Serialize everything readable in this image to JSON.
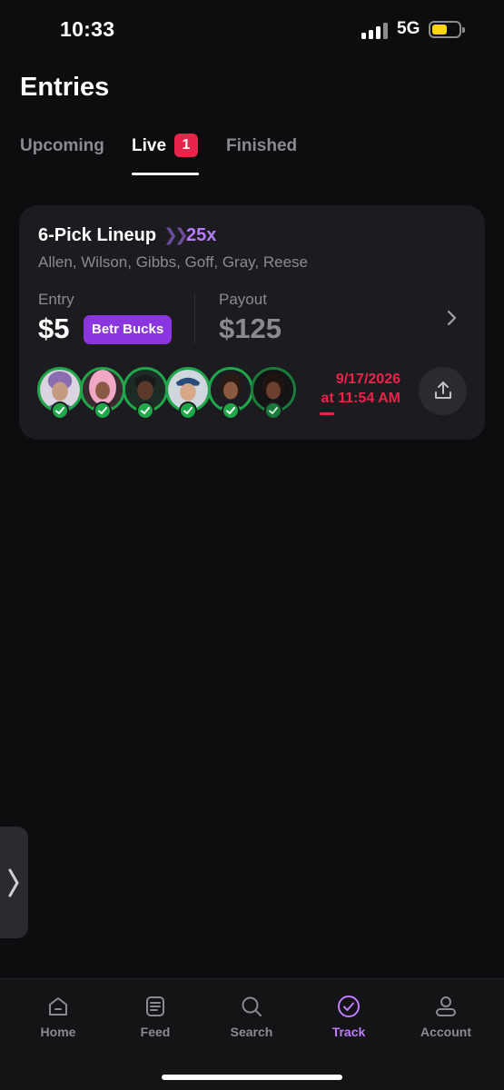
{
  "status_bar": {
    "time": "10:33",
    "network": "5G"
  },
  "page": {
    "title": "Entries"
  },
  "tabs": [
    {
      "label": "Upcoming"
    },
    {
      "label": "Live",
      "badge": "1"
    },
    {
      "label": "Finished"
    }
  ],
  "entry": {
    "title": "6-Pick Lineup",
    "multiplier": "25x",
    "players": "Allen, Wilson, Gibbs, Goff, Gray, Reese",
    "entry_label": "Entry",
    "entry_amount": "$5",
    "entry_badge": "Betr Bucks",
    "payout_label": "Payout",
    "payout_amount": "$125",
    "date": "9/17/2026",
    "time": "at 11:54 AM",
    "avatar_names": [
      "Allen",
      "Wilson",
      "Gibbs",
      "Goff",
      "Gray",
      "Reese"
    ]
  },
  "nav": [
    {
      "label": "Home",
      "icon": "home-icon"
    },
    {
      "label": "Feed",
      "icon": "feed-icon"
    },
    {
      "label": "Search",
      "icon": "search-icon"
    },
    {
      "label": "Track",
      "icon": "check-circle-icon",
      "active": true
    },
    {
      "label": "Account",
      "icon": "user-icon"
    }
  ],
  "colors": {
    "background": "#0d0d0f",
    "card": "#1c1c20",
    "accent_purple": "#b67cff",
    "badge_purple": "#8a35e0",
    "live_red": "#e8244a",
    "check_green": "#1fa84a"
  }
}
